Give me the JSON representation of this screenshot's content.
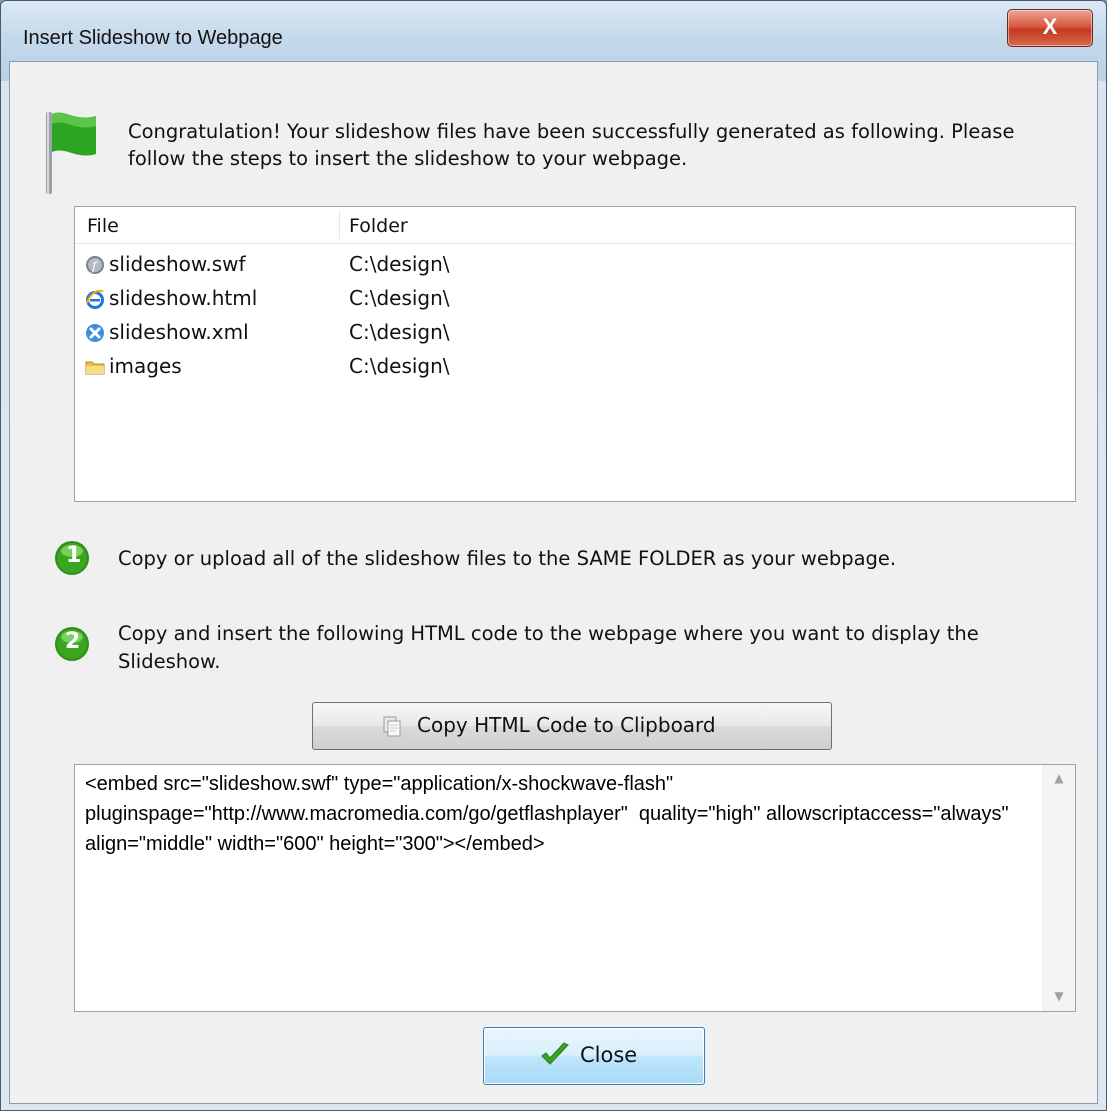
{
  "window": {
    "title": "Insert Slideshow to Webpage",
    "close_glyph": "X"
  },
  "intro": {
    "message": "Congratulation! Your slideshow files have been successfully generated as following. Please follow the steps to insert the slideshow to your webpage.",
    "icon": "green-flag-icon"
  },
  "file_list": {
    "columns": [
      "File",
      "Folder"
    ],
    "rows": [
      {
        "name": "slideshow.swf",
        "folder": "C:\\design\\",
        "icon": "flash-file-icon"
      },
      {
        "name": "slideshow.html",
        "folder": "C:\\design\\",
        "icon": "ie-html-icon"
      },
      {
        "name": "slideshow.xml",
        "folder": "C:\\design\\",
        "icon": "xml-file-icon"
      },
      {
        "name": "images",
        "folder": "C:\\design\\",
        "icon": "folder-icon"
      }
    ]
  },
  "steps": [
    {
      "number": "1",
      "text": "Copy or upload all of the slideshow files to the SAME FOLDER as your webpage."
    },
    {
      "number": "2",
      "text": "Copy and insert the following HTML code to the webpage where you want to display the Slideshow."
    }
  ],
  "copy_button": {
    "label": "Copy HTML Code to Clipboard",
    "icon": "clipboard-icon"
  },
  "code": "<embed src=\"slideshow.swf\" type=\"application/x-shockwave-flash\" pluginspage=\"http://www.macromedia.com/go/getflashplayer\"  quality=\"high\" allowscriptaccess=\"always\" align=\"middle\" width=\"600\" height=\"300\"></embed>",
  "close_button": {
    "label": "Close",
    "icon": "checkmark-icon"
  },
  "colors": {
    "step_badge": "#3aa51f",
    "close_button_accent": "#3c7fb1",
    "titlebar_close": "#c9442a"
  }
}
